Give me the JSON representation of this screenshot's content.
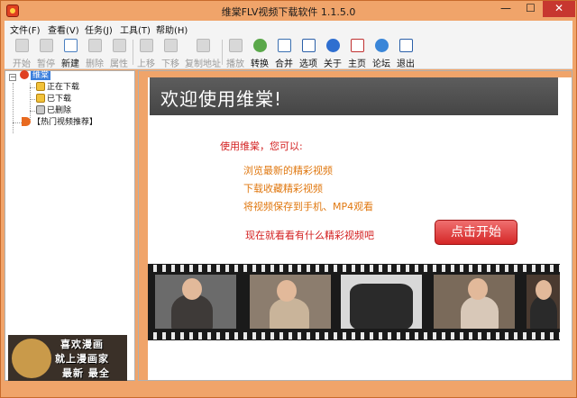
{
  "window": {
    "title": "维棠FLV视频下载软件 1.1.5.0",
    "controls": {
      "minimize": "—",
      "maximize": "☐",
      "close": "✕"
    }
  },
  "menubar": {
    "items": [
      "文件(F)",
      "查看(V)",
      "任务(J)",
      "工具(T)",
      "帮助(H)"
    ]
  },
  "toolbar": {
    "buttons": [
      {
        "label": "开始",
        "icon": "start-icon",
        "enabled": false
      },
      {
        "label": "暂停",
        "icon": "pause-icon",
        "enabled": false
      },
      {
        "label": "新建",
        "icon": "new-icon",
        "enabled": true
      },
      {
        "label": "删除",
        "icon": "delete-icon",
        "enabled": false
      },
      {
        "label": "属性",
        "icon": "properties-icon",
        "enabled": false
      },
      {
        "label": "上移",
        "icon": "move-up-icon",
        "enabled": false
      },
      {
        "label": "下移",
        "icon": "move-down-icon",
        "enabled": false
      },
      {
        "label": "复制地址",
        "icon": "copy-address-icon",
        "enabled": false
      },
      {
        "label": "播放",
        "icon": "play-icon",
        "enabled": false
      },
      {
        "label": "转换",
        "icon": "convert-icon",
        "enabled": true
      },
      {
        "label": "合并",
        "icon": "merge-icon",
        "enabled": true
      },
      {
        "label": "选项",
        "icon": "options-icon",
        "enabled": true
      },
      {
        "label": "关于",
        "icon": "about-icon",
        "enabled": true
      },
      {
        "label": "主页",
        "icon": "homepage-icon",
        "enabled": true
      },
      {
        "label": "论坛",
        "icon": "forum-icon",
        "enabled": true
      },
      {
        "label": "退出",
        "icon": "exit-icon",
        "enabled": true
      }
    ]
  },
  "tree": {
    "root": "维棠",
    "children": [
      "正在下载",
      "已下载",
      "已删除"
    ],
    "featured": "【热门视频推荐】"
  },
  "ad": {
    "lines": [
      "喜欢漫画",
      "就上漫画家",
      "最新 最全"
    ]
  },
  "welcome": {
    "banner": "欢迎使用维棠!",
    "intro": "使用维棠，您可以:",
    "features": [
      "浏览最新的精彩视频",
      "下载收藏精彩视频",
      "将视频保存到手机、MP4观看"
    ],
    "cta": "现在就看看有什么精彩视频吧",
    "start_button": "点击开始"
  },
  "colors": {
    "window_frame": "#f0a46a",
    "banner_bg": "#4f4f4f",
    "accent_red": "#d32020",
    "accent_orange": "#e07810",
    "selection": "#3b7fdc"
  }
}
